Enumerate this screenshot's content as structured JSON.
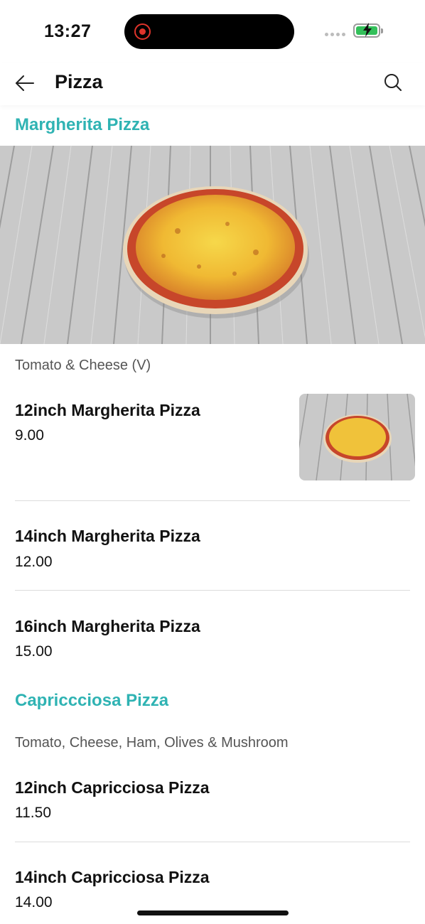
{
  "status_bar": {
    "time": "13:27"
  },
  "header": {
    "title": "Pizza"
  },
  "colors": {
    "accent": "#2fb3b3",
    "recording": "#e0342b",
    "battery": "#33c05a"
  },
  "icons": {
    "back": "arrow-left-icon",
    "search": "search-icon"
  },
  "sections": [
    {
      "title": "Margherita Pizza",
      "description": "Tomato & Cheese (V)",
      "items": [
        {
          "name": "12inch Margherita Pizza",
          "price": "9.00"
        },
        {
          "name": "14inch Margherita Pizza",
          "price": "12.00"
        },
        {
          "name": "16inch Margherita Pizza",
          "price": "15.00"
        }
      ]
    },
    {
      "title": "Capriccciosa Pizza",
      "description": "Tomato, Cheese, Ham, Olives & Mushroom",
      "items": [
        {
          "name": "12inch Capricciosa Pizza",
          "price": "11.50"
        },
        {
          "name": "14inch Capricciosa Pizza",
          "price": "14.00"
        }
      ]
    }
  ]
}
